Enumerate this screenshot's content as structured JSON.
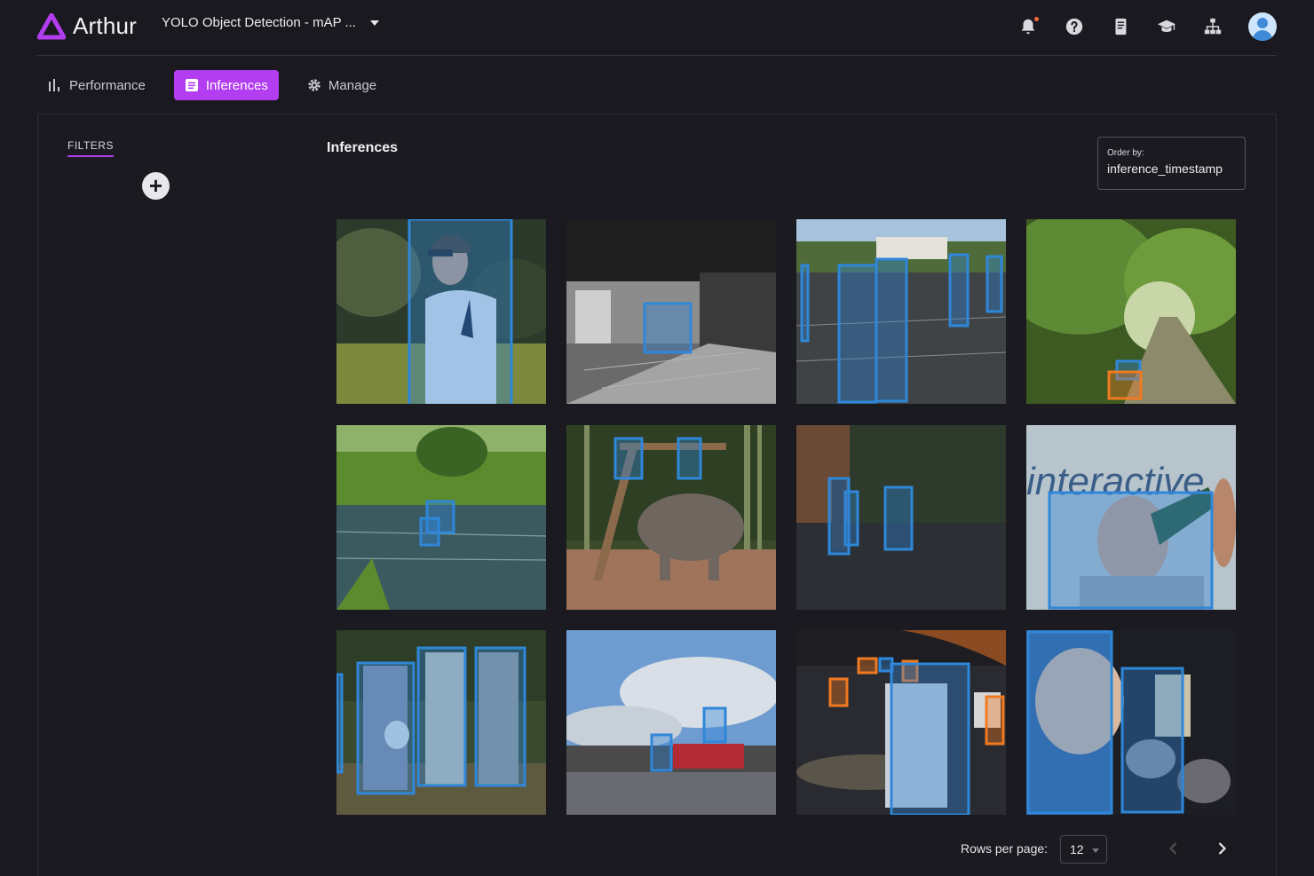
{
  "app": {
    "name": "Arthur",
    "model_title": "YOLO Object Detection - mAP ..."
  },
  "header": {
    "icons": [
      "bell-icon",
      "help-icon",
      "docs-icon",
      "academy-icon",
      "org-chart-icon",
      "user-avatar"
    ]
  },
  "tabs": [
    {
      "label": "Performance",
      "icon": "bar-chart-icon",
      "active": false
    },
    {
      "label": "Inferences",
      "icon": "list-icon",
      "active": true
    },
    {
      "label": "Manage",
      "icon": "gear-icon",
      "active": false
    }
  ],
  "filters": {
    "label": "FILTERS"
  },
  "inferences": {
    "title": "Inferences",
    "order_by_label": "Order by:",
    "order_by_value": "inference_timestamp",
    "images": [
      {
        "scene": "man in white t-shirt with sunglasses and earphones"
      },
      {
        "scene": "black-and-white street market with seated person"
      },
      {
        "scene": "children standing on a school parking lot"
      },
      {
        "scene": "forest path with small figure and orange box"
      },
      {
        "scene": "person wading in a green river"
      },
      {
        "scene": "elephant beside wooden scaffold with two people"
      },
      {
        "scene": "people near a building at dusk"
      },
      {
        "scene": "man drinking from green bottle in front of 'interactive' sign"
      },
      {
        "scene": "three street musicians with drum, saxophone and accordion"
      },
      {
        "scene": "cyclists on cobbled road under blue sky"
      },
      {
        "scene": "man at desk in a broadcast studio"
      },
      {
        "scene": "drummer on stage with blue sleeve in foreground"
      }
    ],
    "overlay_text": "interactive"
  },
  "pagination": {
    "rows_label": "Rows per page:",
    "rows_value": "12"
  },
  "colors": {
    "accent": "#b33df0",
    "box_blue": "#2f87d9",
    "box_orange": "#f07a22",
    "background": "#1a191f"
  }
}
